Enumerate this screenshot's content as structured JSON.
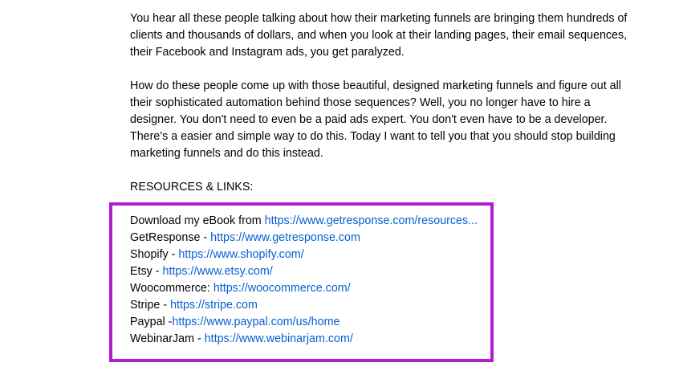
{
  "description": {
    "paragraph1": "You hear all these people talking about how their marketing funnels are bringing them hundreds of clients and thousands of dollars, and when you look at their landing pages, their email sequences, their Facebook and Instagram ads, you get paralyzed.",
    "paragraph1_lines": [
      "You hear all these people talking about how their marketing funnels are bringing them hundreds of",
      "clients and thousands of dollars, and when you look at their landing pages, their email sequences,",
      "their Facebook and Instagram ads, you get paralyzed."
    ],
    "paragraph2_lines": [
      "How do these people come up with those beautiful, designed marketing funnels and figure out all",
      "their sophisticated automation behind those sequences? Well, you no longer have to hire a",
      "designer. You don't need to even be a paid ads expert. You don't even have to be a developer.",
      "There's a easier and simple way to do this. Today I want to tell you that you should stop building",
      "marketing funnels and do this instead."
    ],
    "resources_heading": "RESOURCES & LINKS:",
    "divider": "____________________________________________",
    "links": [
      {
        "prefix": "Download my eBook from ",
        "url": "https://www.getresponse.com/resources..."
      },
      {
        "prefix": "GetResponse - ",
        "url": "https://www.getresponse.com"
      },
      {
        "prefix": "Shopify - ",
        "url": "https://www.shopify.com/"
      },
      {
        "prefix": "Etsy - ",
        "url": "https://www.etsy.com/"
      },
      {
        "prefix": "Woocommerce: ",
        "url": "https://woocommerce.com/"
      },
      {
        "prefix": "Stripe - ",
        "url": "https://stripe.com"
      },
      {
        "prefix": "Paypal -",
        "url": "https://www.paypal.com/us/home"
      },
      {
        "prefix": "WebinarJam - ",
        "url": "https://www.webinarjam.com/"
      }
    ]
  },
  "colors": {
    "text": "#030303",
    "link": "#065fd4",
    "highlight_border": "#b01ed2"
  }
}
